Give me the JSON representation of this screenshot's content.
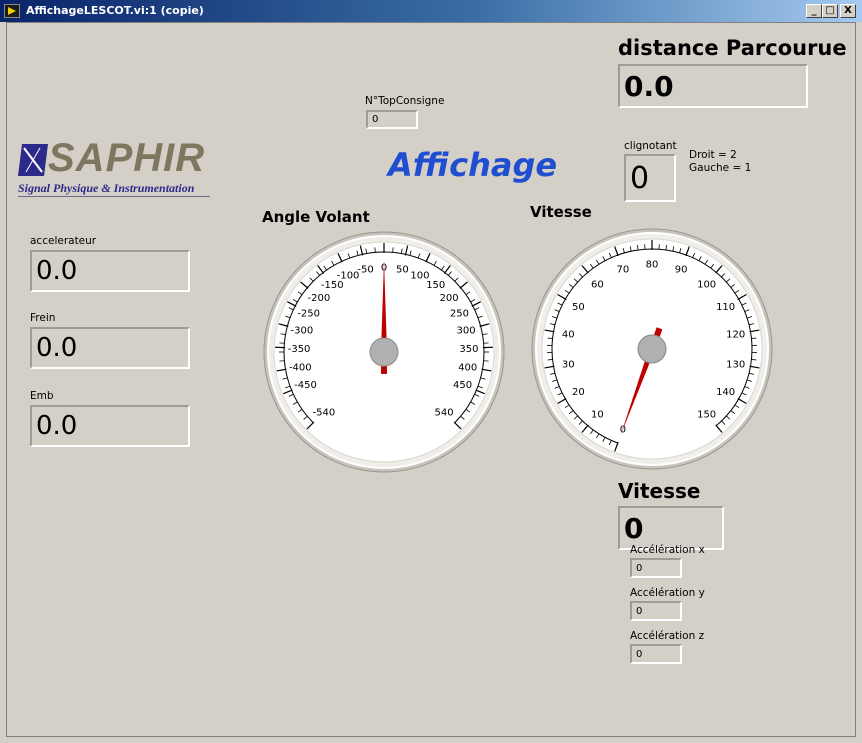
{
  "window": {
    "title": "AffichageLESCOT.vi:1 (copie)",
    "buttons": {
      "minimize": "_",
      "maximize": "□",
      "close": "X"
    }
  },
  "logo": {
    "name": "SAPHIR",
    "subtitle": "Signal Physique & Instrumentation"
  },
  "header": {
    "title": "Affichage"
  },
  "top_consigne": {
    "label": "N°TopConsigne",
    "value": "0"
  },
  "distance": {
    "label": "distance Parcourue",
    "value": "0.0"
  },
  "clignotant": {
    "label": "clignotant",
    "value": "0",
    "legend_droit": "Droit = 2",
    "legend_gauche": "Gauche = 1"
  },
  "accelerateur": {
    "label": "accelerateur",
    "value": "0.0"
  },
  "frein": {
    "label": "Frein",
    "value": "0.0"
  },
  "emb": {
    "label": "Emb",
    "value": "0.0"
  },
  "angle_volant": {
    "label": "Angle Volant",
    "min": -540,
    "max": 540,
    "value": 0,
    "ticks": [
      "-540",
      "-450",
      "-400",
      "-350",
      "-300",
      "-250",
      "-200",
      "-150",
      "-100",
      "-50",
      "0",
      "50",
      "100",
      "150",
      "200",
      "250",
      "300",
      "350",
      "400",
      "450",
      "540"
    ],
    "tick_values": [
      -540,
      -450,
      -400,
      -350,
      -300,
      -250,
      -200,
      -150,
      -100,
      -50,
      0,
      50,
      100,
      150,
      200,
      250,
      300,
      350,
      400,
      450,
      540
    ]
  },
  "vitesse_gauge": {
    "label": "Vitesse",
    "min": 0,
    "max": 150,
    "value": 0,
    "ticks": [
      "0",
      "10",
      "20",
      "30",
      "40",
      "50",
      "60",
      "70",
      "80",
      "90",
      "100",
      "110",
      "120",
      "130",
      "140",
      "150"
    ],
    "tick_values": [
      0,
      10,
      20,
      30,
      40,
      50,
      60,
      70,
      80,
      90,
      100,
      110,
      120,
      130,
      140,
      150
    ]
  },
  "vitesse_display": {
    "label": "Vitesse",
    "value": "0"
  },
  "acceleration_x": {
    "label": "Accélération x",
    "value": "0"
  },
  "acceleration_y": {
    "label": "Accélération y",
    "value": "0"
  },
  "acceleration_z": {
    "label": "Accélération z",
    "value": "0"
  },
  "colors": {
    "needle": "#c00000",
    "hub": "#b0b0b0",
    "title_blue": "#1f4fd0",
    "logo_gold": "#7f7660",
    "logo_navy": "#2b2a8a"
  }
}
